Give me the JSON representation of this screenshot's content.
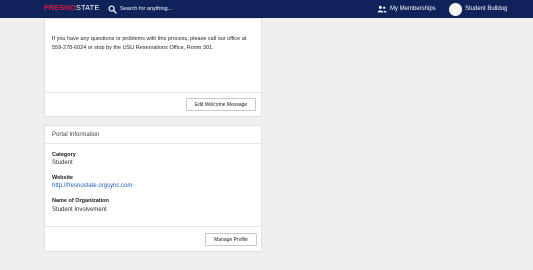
{
  "header": {
    "logo_red": "FRESNO",
    "logo_white": "STATE",
    "search_placeholder": "Search for anything...",
    "memberships_label": "My Memberships",
    "user_name": "Student Bulldog"
  },
  "welcome": {
    "message": "If you have any questions or problems with this process, please call our office at 559-278-6024 or stop by the USU Reservations Office, Room 301.",
    "edit_button": "Edit Welcome Message"
  },
  "portal": {
    "title": "Portal Information",
    "category_label": "Category",
    "category_value": "Student",
    "website_label": "Website",
    "website_value": "http://fresnostate.orgsync.com",
    "org_label": "Name of Organization",
    "org_value": "Student Involvement",
    "manage_button": "Manage Profile"
  },
  "colors": {
    "header_bg": "#10225a",
    "logo_red": "#d6183e",
    "link": "#1d5bb8"
  },
  "icons": [
    "search-icon",
    "people-icon",
    "avatar"
  ]
}
